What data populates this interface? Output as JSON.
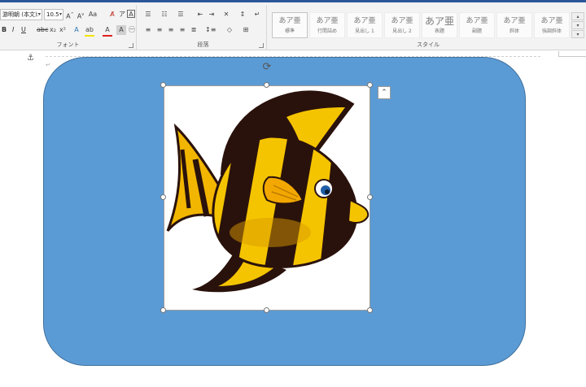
{
  "ribbon": {
    "font_group": {
      "label": "フォント",
      "font_name": "游明朝 (本文):",
      "font_size": "10.5",
      "bold": "B",
      "italic": "I",
      "underline": "U"
    },
    "paragraph_group": {
      "label": "段落"
    },
    "styles_group": {
      "label": "スタイル",
      "items": [
        {
          "sample": "あア亜",
          "name": "標準"
        },
        {
          "sample": "あア亜",
          "name": "行間詰め"
        },
        {
          "sample": "あア亜",
          "name": "見出し 1"
        },
        {
          "sample": "あア亜",
          "name": "見出し 2"
        },
        {
          "sample": "あア亜",
          "name": "表題"
        },
        {
          "sample": "あア亜",
          "name": "副題"
        },
        {
          "sample": "あア亜",
          "name": "斜体"
        },
        {
          "sample": "あア亜",
          "name": "強調斜体"
        }
      ]
    }
  },
  "document": {
    "shape_fill": "#5b9bd5",
    "picture_subject": "fish-clipart"
  },
  "colors": {
    "accent": "#2b579a",
    "font_color_swatch": "#e02020",
    "highlight_swatch": "#f5e400"
  }
}
